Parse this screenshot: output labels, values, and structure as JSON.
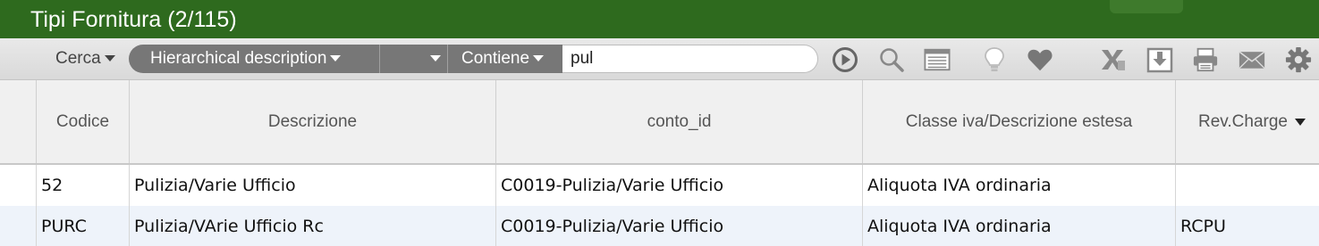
{
  "window": {
    "title": "Tipi Fornitura (2/115)"
  },
  "search": {
    "label": "Cerca",
    "field": "Hierarchical description",
    "operator_blank": "",
    "condition": "Contiene",
    "value": "pul"
  },
  "toolbar": {
    "icons": [
      "play-circle-icon",
      "search-icon",
      "list-icon",
      "lightbulb-icon",
      "heart-icon",
      "excel-icon",
      "download-icon",
      "print-icon",
      "mail-icon",
      "gear-icon"
    ]
  },
  "table": {
    "columns": [
      "Codice",
      "Descrizione",
      "conto_id",
      "Classe iva/Descrizione estesa",
      "Rev.Charge"
    ],
    "rows": [
      [
        "52",
        "Pulizia/Varie Ufficio",
        "C0019-Pulizia/Varie Ufficio",
        "Aliquota IVA ordinaria",
        ""
      ],
      [
        "PURC",
        "Pulizia/VArie Ufficio Rc",
        "C0019-Pulizia/Varie Ufficio",
        "Aliquota IVA ordinaria",
        "RCPU"
      ]
    ]
  },
  "colors": {
    "titlebar": "#2e6a1e",
    "segment": "#777777",
    "row_alt": "#eef3fa"
  }
}
